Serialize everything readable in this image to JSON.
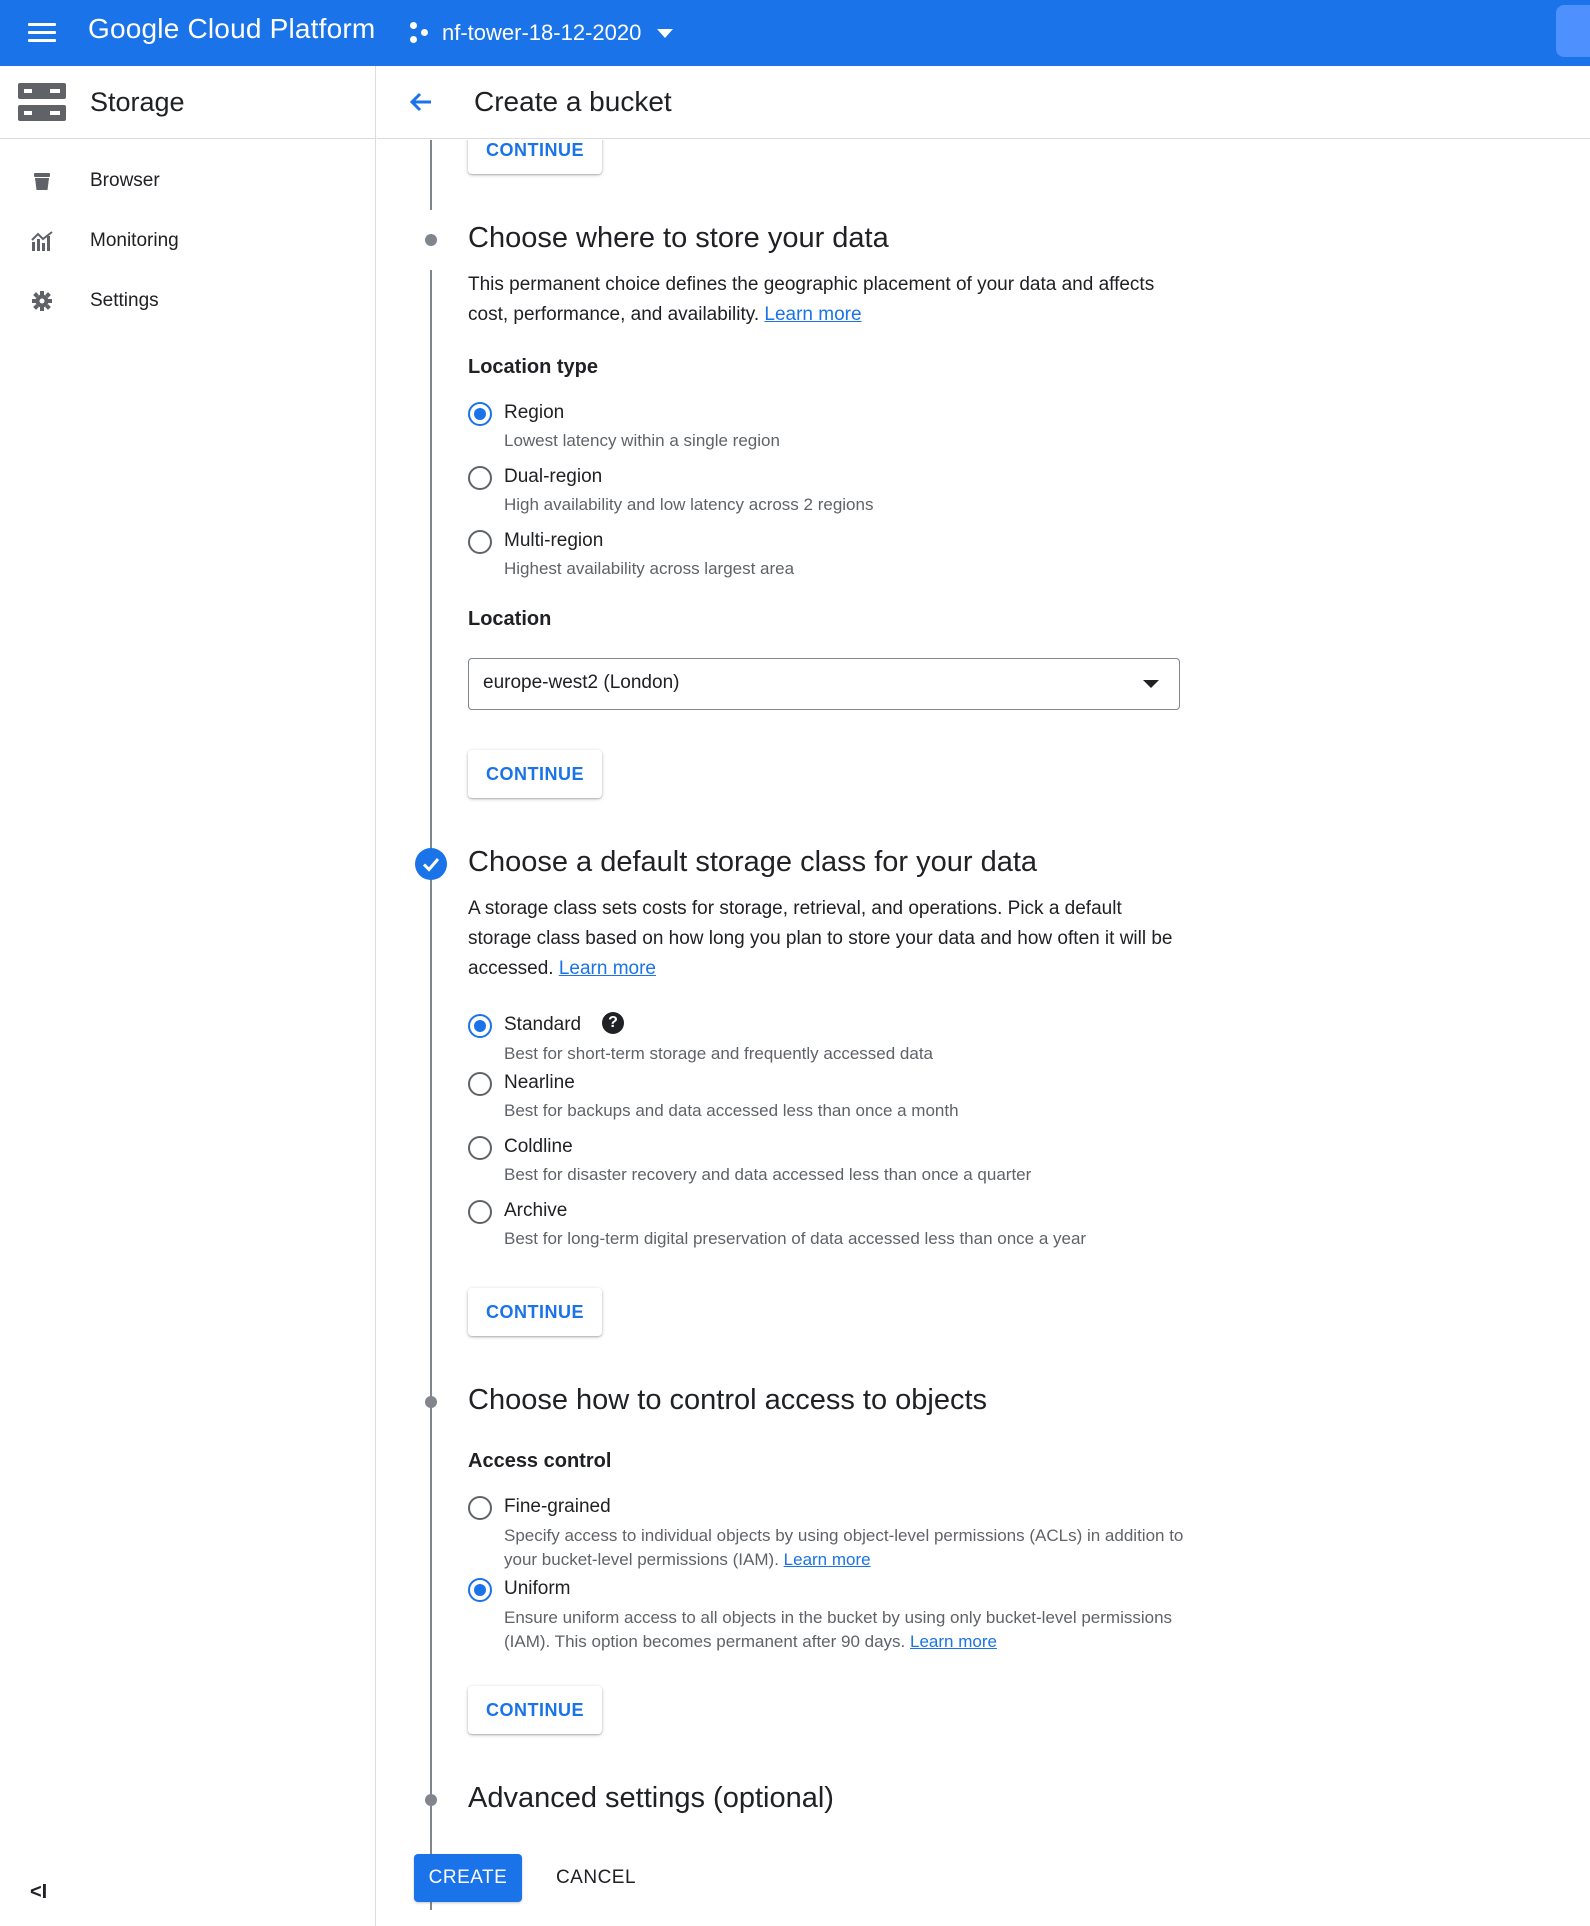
{
  "topbar": {
    "brand": "Google Cloud Platform",
    "project": "nf-tower-18-12-2020",
    "menu_icon": "hamburger-menu-icon",
    "project_icon": "project-hub-icon",
    "accent": "#1a73e8"
  },
  "sidebar": {
    "title": "Storage",
    "items": [
      {
        "label": "Browser",
        "icon": "bucket-icon"
      },
      {
        "label": "Monitoring",
        "icon": "chart-icon"
      },
      {
        "label": "Settings",
        "icon": "gear-icon"
      }
    ],
    "collapse_label": "<I"
  },
  "header": {
    "title": "Create a bucket",
    "back_icon": "arrow-back-icon"
  },
  "steps": {
    "prev_continue": "CONTINUE",
    "location": {
      "title": "Choose where to store your data",
      "desc": "This permanent choice defines the geographic placement of your data and affects cost, performance, and availability.",
      "learn_more": "Learn more",
      "type_label": "Location type",
      "options": [
        {
          "label": "Region",
          "help": "Lowest latency within a single region",
          "selected": true
        },
        {
          "label": "Dual-region",
          "help": "High availability and low latency across 2 regions",
          "selected": false
        },
        {
          "label": "Multi-region",
          "help": "Highest availability across largest area",
          "selected": false
        }
      ],
      "location_label": "Location",
      "location_value": "europe-west2 (London)",
      "continue": "CONTINUE"
    },
    "storage_class": {
      "title": "Choose a default storage class for your data",
      "desc": "A storage class sets costs for storage, retrieval, and operations. Pick a default storage class based on how long you plan to store your data and how often it will be accessed.",
      "learn_more": "Learn more",
      "options": [
        {
          "label": "Standard",
          "help": "Best for short-term storage and frequently accessed data",
          "selected": true
        },
        {
          "label": "Nearline",
          "help": "Best for backups and data accessed less than once a month",
          "selected": false
        },
        {
          "label": "Coldline",
          "help": "Best for disaster recovery and data accessed less than once a quarter",
          "selected": false
        },
        {
          "label": "Archive",
          "help": "Best for long-term digital preservation of data accessed less than once a year",
          "selected": false
        }
      ],
      "help_glyph": "?",
      "continue": "CONTINUE"
    },
    "access": {
      "title": "Choose how to control access to objects",
      "label": "Access control",
      "options": [
        {
          "label": "Fine-grained",
          "help": "Specify access to individual objects by using object-level permissions (ACLs) in addition to your bucket-level permissions (IAM).",
          "learn_more": "Learn more",
          "selected": false
        },
        {
          "label": "Uniform",
          "help": "Ensure uniform access to all objects in the bucket by using only bucket-level permissions (IAM). This option becomes permanent after 90 days.",
          "learn_more": "Learn more",
          "selected": true
        }
      ],
      "continue": "CONTINUE"
    },
    "advanced": {
      "title": "Advanced settings (optional)"
    }
  },
  "actions": {
    "create": "CREATE",
    "cancel": "CANCEL"
  }
}
